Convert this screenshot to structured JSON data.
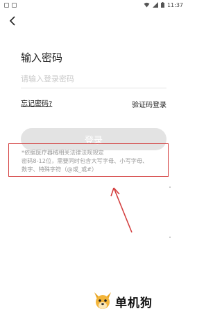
{
  "status_bar": {
    "time": "11:37",
    "icons": [
      "wifi-icon",
      "signal-icon",
      "battery-icon"
    ]
  },
  "header": {
    "back_icon": "chevron-left-icon"
  },
  "login": {
    "title": "输入密码",
    "password_placeholder": "请输入登录密码",
    "password_value": "",
    "forgot_label": "忘记密码?",
    "sms_login_label": "验证码登录",
    "login_button_label": "登录"
  },
  "notice": {
    "line1": "*依据医疗器械相关法律法规规定",
    "line2": "密码8-12位，需要同时包含大写字母、小写字母、",
    "line3": "数字、特殊字符（@或_或#）"
  },
  "watermark": {
    "text": "单机狗"
  },
  "colors": {
    "annotation": "#d33d3d",
    "button_disabled": "#e3e3e3"
  }
}
